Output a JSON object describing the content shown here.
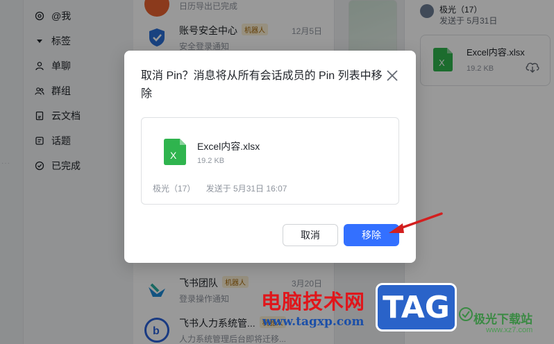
{
  "nav": {
    "items": [
      {
        "label": "@我",
        "icon": "at-icon"
      },
      {
        "label": "标签",
        "icon": "triangle-down-icon"
      },
      {
        "label": "单聊",
        "icon": "user-icon"
      },
      {
        "label": "群组",
        "icon": "group-icon"
      },
      {
        "label": "云文档",
        "icon": "document-icon"
      },
      {
        "label": "话题",
        "icon": "topic-icon"
      },
      {
        "label": "已完成",
        "icon": "check-circle-icon"
      }
    ]
  },
  "conversations": [
    {
      "name": "",
      "tag": "",
      "date": "",
      "sub": "日历导出已完成",
      "color": "#e8622f"
    },
    {
      "name": "账号安全中心",
      "tag": "机器人",
      "date": "12月5日",
      "sub": "安全登录通知",
      "color": "#2a6fd6"
    },
    {
      "name": "飞书团队",
      "tag": "机器人",
      "date": "3月20日",
      "sub": "登录操作通知",
      "color": "#1d8ad8"
    },
    {
      "name": "飞书人力系统管...",
      "tag": "机器人",
      "date": "",
      "sub": "人力系统管理后台即将迁移...",
      "color": "#2b62d9"
    }
  ],
  "right_panel": {
    "sender": "极光（17）",
    "sent": "发送于 5月31日",
    "file_name": "Excel内容.xlsx",
    "file_size": "19.2 KB"
  },
  "dialog": {
    "title": "取消 Pin？消息将从所有会话成员的 Pin 列表中移除",
    "file_name": "Excel内容.xlsx",
    "file_size": "19.2 KB",
    "sender": "极光（17）",
    "sent_time": "发送于 5月31日 16:07",
    "cancel_label": "取消",
    "remove_label": "移除"
  },
  "watermark": {
    "cn_text": "电脑技术网",
    "url": "www.tagxp.com",
    "tag": "TAG",
    "site": "极光下载站",
    "site_url": "www.xz7.com"
  },
  "colors": {
    "primary": "#3370ff",
    "excel_green": "#2fb44e",
    "bot_tag_bg": "#fcf0d4"
  }
}
